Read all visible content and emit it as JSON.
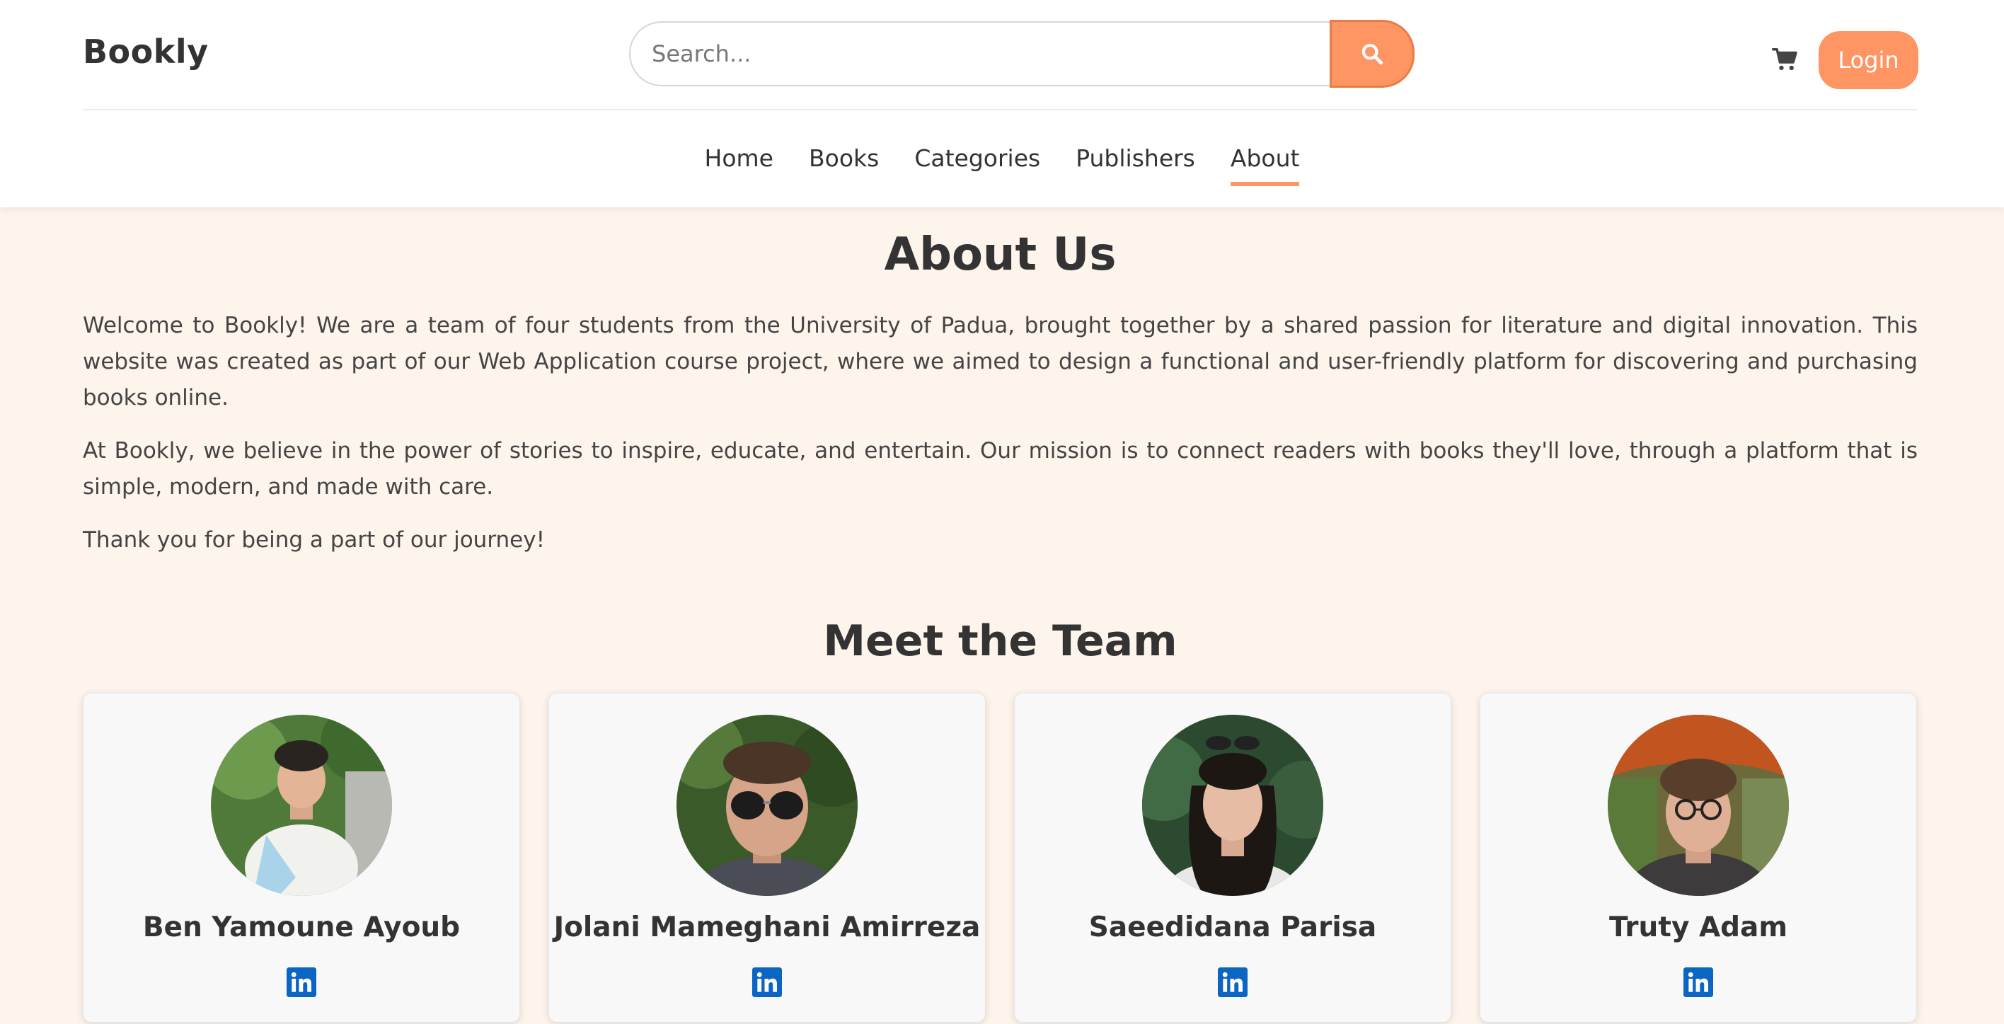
{
  "header": {
    "logo": "Bookly",
    "search": {
      "placeholder": "Search...",
      "value": ""
    },
    "login_label": "Login",
    "nav": [
      {
        "label": "Home",
        "active": false
      },
      {
        "label": "Books",
        "active": false
      },
      {
        "label": "Categories",
        "active": false
      },
      {
        "label": "Publishers",
        "active": false
      },
      {
        "label": "About",
        "active": true
      }
    ]
  },
  "main": {
    "title": "About Us",
    "paragraphs": [
      "Welcome to Bookly! We are a team of four students from the University of Padua, brought together by a shared passion for literature and digital innovation. This website was created as part of our Web Application course project, where we aimed to design a functional and user-friendly platform for discovering and purchasing books online.",
      "At Bookly, we believe in the power of stories to inspire, educate, and entertain. Our mission is to connect readers with books they'll love, through a platform that is simple, modern, and made with care.",
      "Thank you for being a part of our journey!"
    ],
    "team_title": "Meet the Team",
    "team": [
      {
        "name": "Ben Yamoune Ayoub",
        "icon": "linkedin-icon"
      },
      {
        "name": "Jolani Mameghani Amirreza",
        "icon": "linkedin-icon"
      },
      {
        "name": "Saeedidana Parisa",
        "icon": "linkedin-icon"
      },
      {
        "name": "Truty Adam",
        "icon": "linkedin-icon"
      }
    ]
  },
  "colors": {
    "accent": "#ff9563",
    "page_background": "#fdf4eb",
    "linkedin": "#0a66c2"
  }
}
